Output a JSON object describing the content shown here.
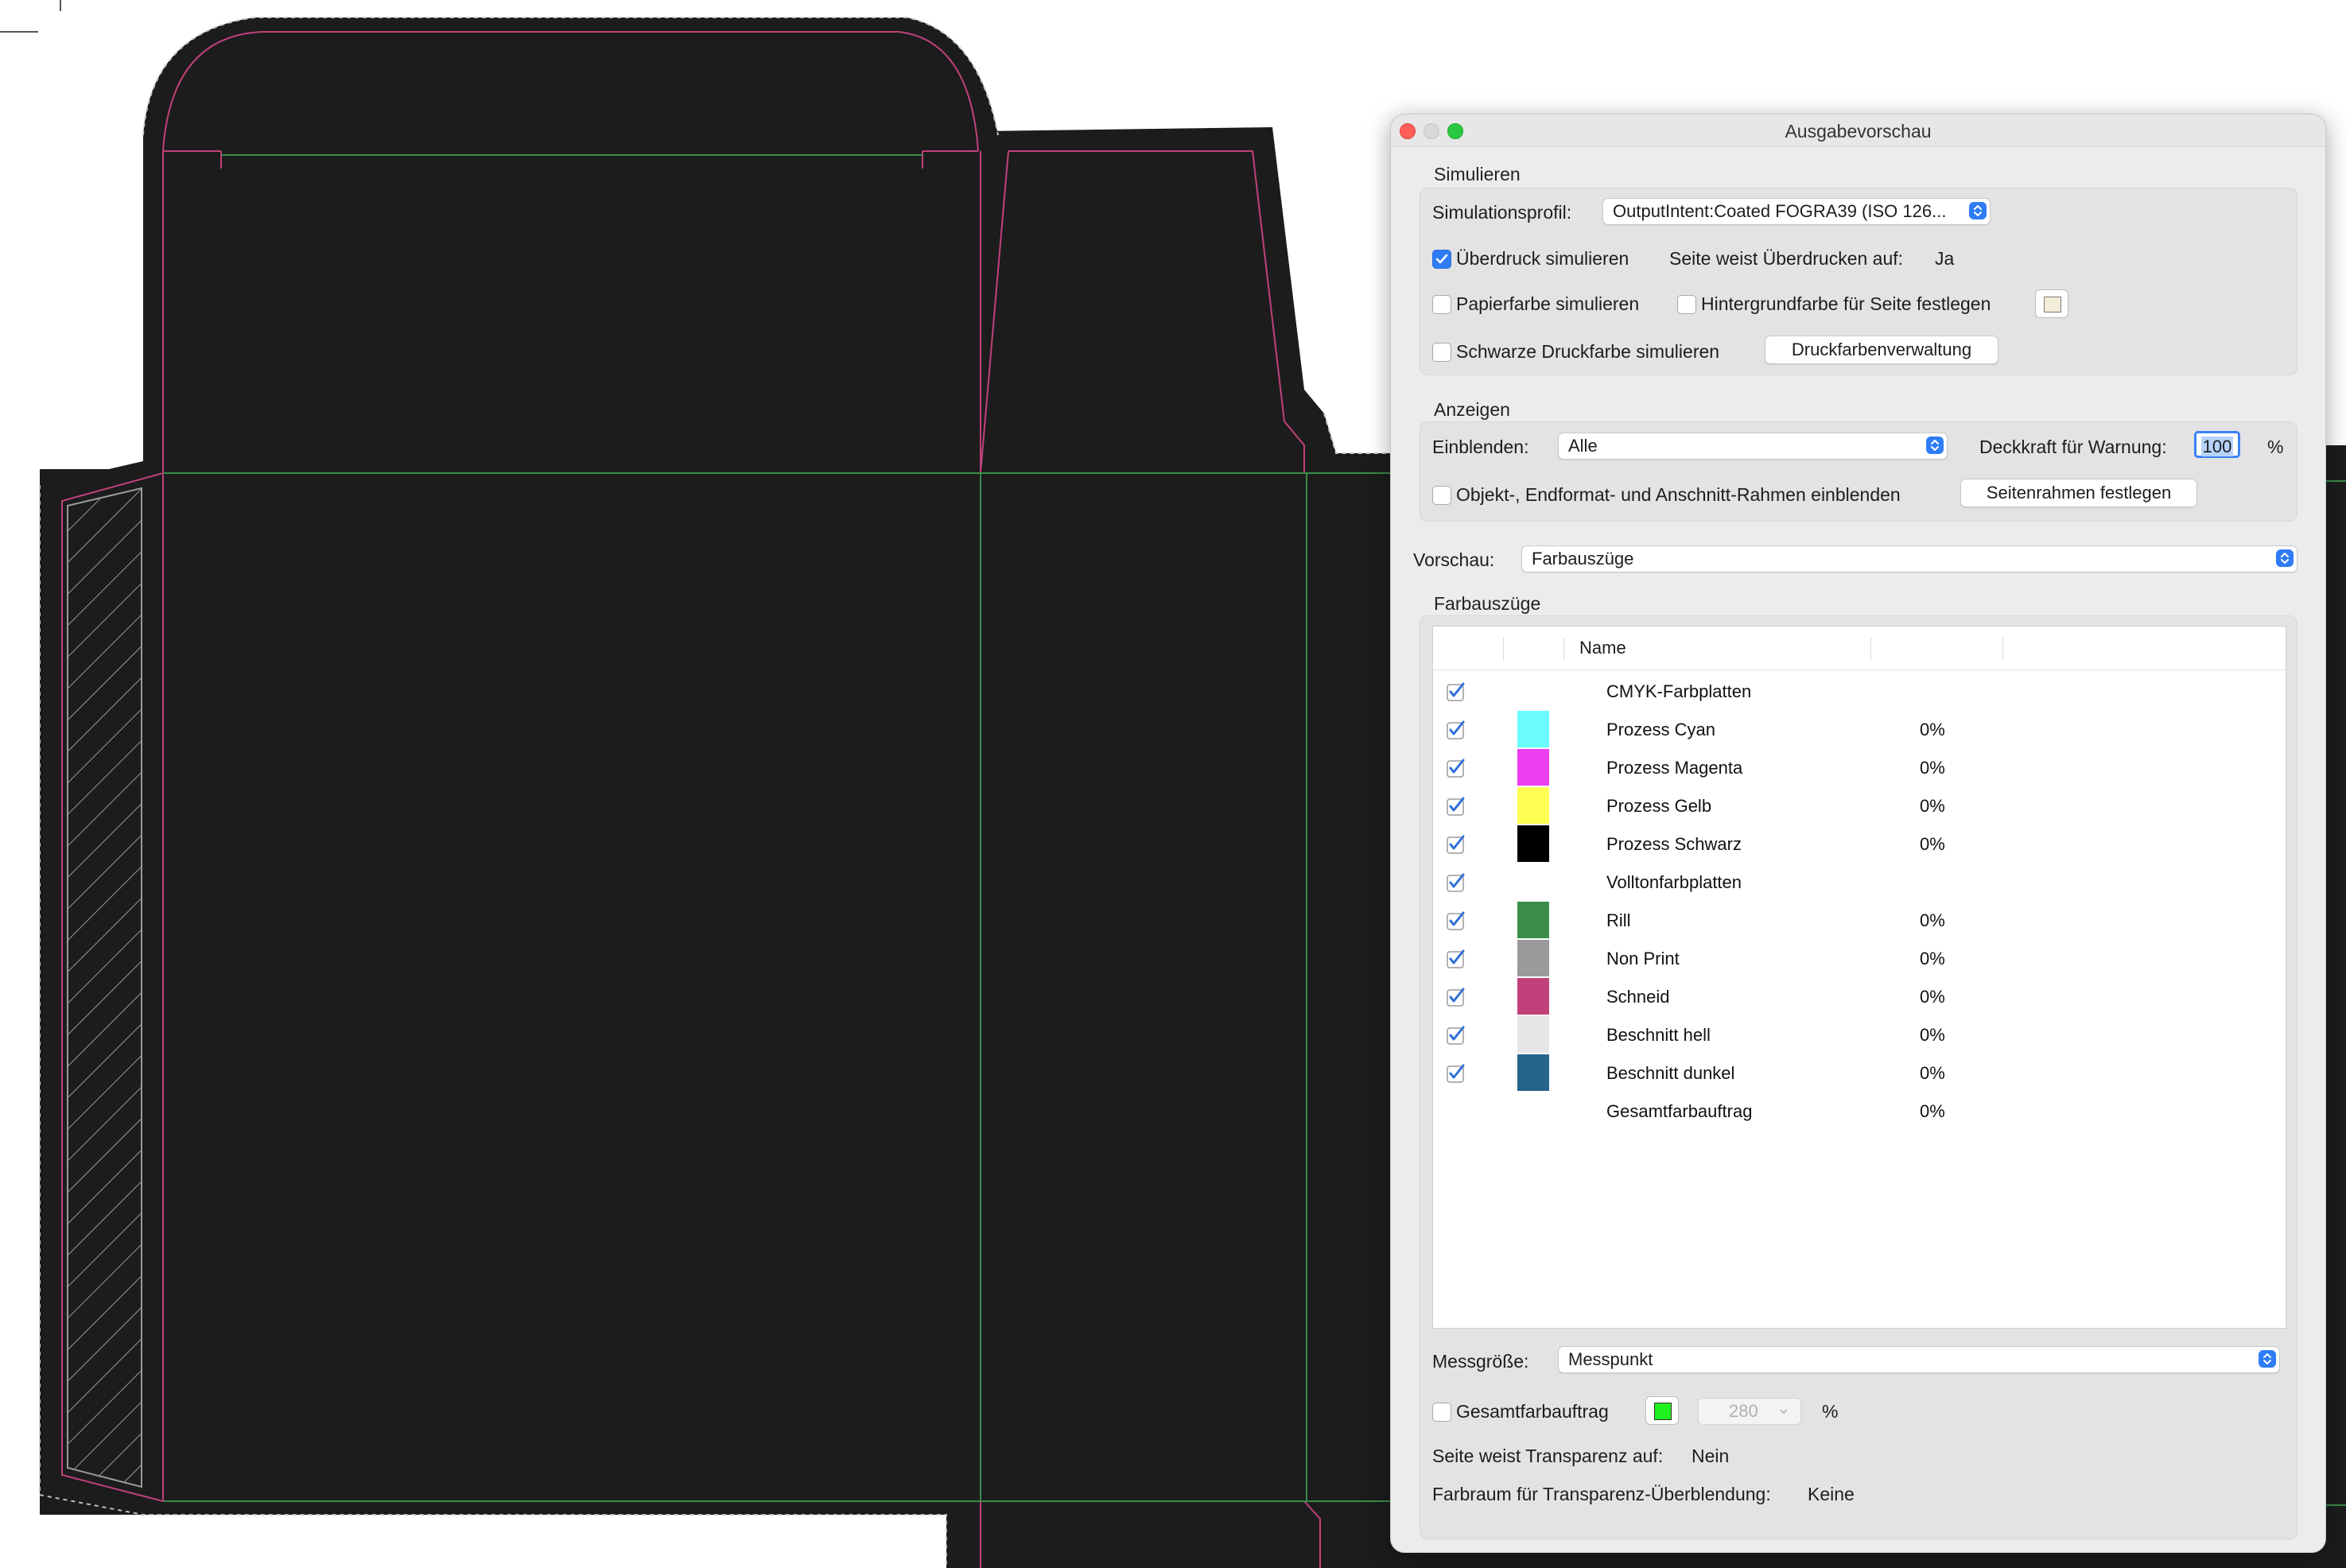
{
  "dialog": {
    "title": "Ausgabevorschau",
    "simulate": {
      "section_label": "Simulieren",
      "profile_label": "Simulationsprofil:",
      "profile_value": "OutputIntent:Coated FOGRA39 (ISO 126...",
      "overprint_label": "Überdruck simulieren",
      "overprint_checked": true,
      "page_overprint_label": "Seite weist Überdrucken auf:",
      "page_overprint_value": "Ja",
      "paper_label": "Papierfarbe simulieren",
      "paper_checked": false,
      "bg_label": "Hintergrundfarbe für Seite festlegen",
      "bg_checked": false,
      "black_label": "Schwarze Druckfarbe simulieren",
      "black_checked": false,
      "ink_button": "Druckfarbenverwaltung"
    },
    "display": {
      "section_label": "Anzeigen",
      "show_label": "Einblenden:",
      "show_value": "Alle",
      "opacity_label": "Deckkraft für Warnung:",
      "opacity_value": "100",
      "opacity_unit": "%",
      "frames_label": "Objekt-, Endformat- und Anschnitt-Rahmen einblenden",
      "frames_checked": false,
      "page_frames_button": "Seitenrahmen festlegen"
    },
    "preview": {
      "label": "Vorschau:",
      "value": "Farbauszüge"
    },
    "separations": {
      "section_label": "Farbauszüge",
      "col_name": "Name",
      "rows": [
        {
          "name": "CMYK-Farbplatten",
          "checked": true,
          "color": "",
          "pct": ""
        },
        {
          "name": "Prozess Cyan",
          "checked": true,
          "color": "#6cfbfd",
          "pct": "0%"
        },
        {
          "name": "Prozess Magenta",
          "checked": true,
          "color": "#ee3ff0",
          "pct": "0%"
        },
        {
          "name": "Prozess Gelb",
          "checked": true,
          "color": "#fefe53",
          "pct": "0%"
        },
        {
          "name": "Prozess Schwarz",
          "checked": true,
          "color": "#000000",
          "pct": "0%"
        },
        {
          "name": "Volltonfarbplatten",
          "checked": true,
          "color": "",
          "pct": ""
        },
        {
          "name": "Rill",
          "checked": true,
          "color": "#3b8c4a",
          "pct": "0%"
        },
        {
          "name": "Non Print",
          "checked": true,
          "color": "#9a9a9a",
          "pct": "0%"
        },
        {
          "name": "Schneid",
          "checked": true,
          "color": "#c0417a",
          "pct": "0%"
        },
        {
          "name": "Beschnitt hell",
          "checked": true,
          "color": "#e6e6e6",
          "pct": "0%"
        },
        {
          "name": "Beschnitt dunkel",
          "checked": true,
          "color": "#27648a",
          "pct": "0%"
        },
        {
          "name": "Gesamtfarbauftrag",
          "checked": false,
          "color": "",
          "pct": "0%"
        }
      ]
    },
    "measure": {
      "label": "Messgröße:",
      "value": "Messpunkt",
      "total_label": "Gesamtfarbauftrag",
      "total_checked": false,
      "total_value": "280",
      "total_unit": "%",
      "transparency_label": "Seite weist Transparenz auf:",
      "transparency_value": "Nein",
      "blend_label": "Farbraum für Transparenz-Überblendung:",
      "blend_value": "Keine"
    }
  },
  "colors": {
    "artwork": "#1c1c1c",
    "cut_line": "#c0417a",
    "crease_line": "#3b8c4a",
    "accent": "#2f7cf6"
  }
}
